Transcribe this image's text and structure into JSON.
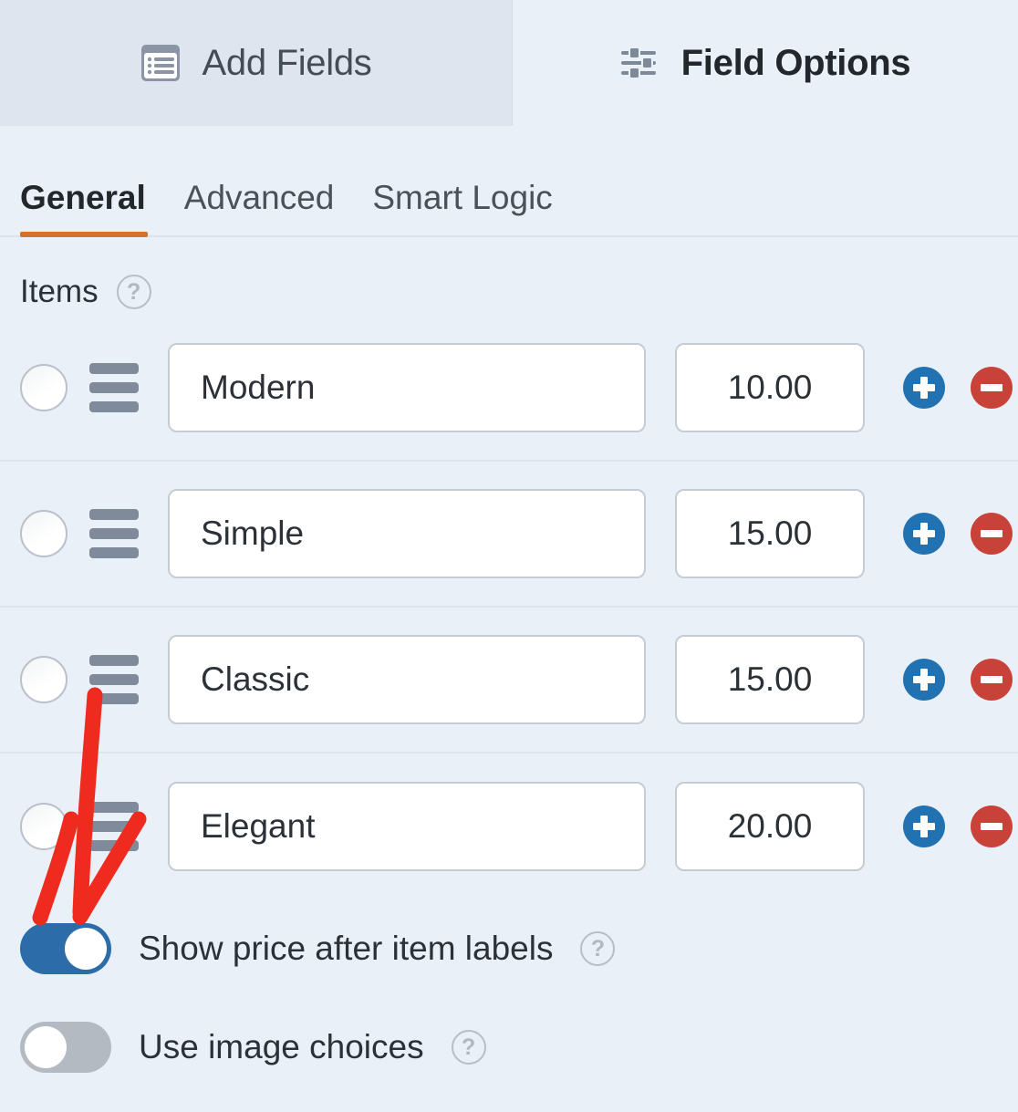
{
  "panel": {
    "tabs": [
      {
        "label": "Add Fields",
        "icon": "list-fields-icon",
        "active": false
      },
      {
        "label": "Field Options",
        "icon": "sliders-icon",
        "active": true
      }
    ]
  },
  "sub_tabs": [
    {
      "label": "General",
      "active": true
    },
    {
      "label": "Advanced",
      "active": false
    },
    {
      "label": "Smart Logic",
      "active": false
    }
  ],
  "items_section": {
    "label": "Items",
    "help_glyph": "?",
    "rows": [
      {
        "label": "Modern",
        "price": "10.00",
        "add_label": "+",
        "remove_label": "−"
      },
      {
        "label": "Simple",
        "price": "15.00",
        "add_label": "+",
        "remove_label": "−"
      },
      {
        "label": "Classic",
        "price": "15.00",
        "add_label": "+",
        "remove_label": "−"
      },
      {
        "label": "Elegant",
        "price": "20.00",
        "add_label": "+",
        "remove_label": "−"
      }
    ]
  },
  "toggles": [
    {
      "label": "Show price after item labels",
      "state": "on",
      "help_glyph": "?"
    },
    {
      "label": "Use image choices",
      "state": "off",
      "help_glyph": "?"
    }
  ],
  "colors": {
    "accent_orange": "#d2722f",
    "toggle_on_blue": "#2c6ca8",
    "add_blue": "#2271b1",
    "remove_red": "#c9423a",
    "annotation_red": "#ef2b1f",
    "panel_bg": "#eaf0f8",
    "inactive_tab_bg": "#dfe5ee"
  }
}
